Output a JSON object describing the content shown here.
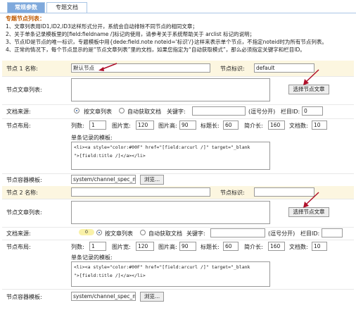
{
  "tabs": [
    {
      "label": "常规参数",
      "active": true
    },
    {
      "label": "专题文档",
      "active": false
    }
  ],
  "notes": {
    "title": "专题节点列表：",
    "lines": [
      "1、文章列表用ID1,ID2,ID3这样形式分开，系统会自动排除不同节点的相同文章；",
      "2、关于单条记录模板里的[field:fieldname /]标记的使用，请参考关于系统帮助关于 arclist 标记的说明；",
      "3、节点ID是节点的唯一标识，专题模板中用{dede:field.note noteid='标识'/}这样来表示单个节点，不指定noteid时为所有节点列表。",
      "4、正常的情况下，每个节点显示的是“节点文章列表”里的文档，如果您指定为“自动获取模式”，那么必须指定关键字和栏目ID。"
    ]
  },
  "node1": {
    "name_label": "节点 1 名称:",
    "name_value": "默认节点",
    "id_label": "节点标识:",
    "id_value": "default",
    "list_label": "节点文章列表:",
    "select_button": "选择节点文章",
    "source_label": "文档来源:",
    "source_opt1": "按文章列表",
    "source_opt2": "自动获取文档",
    "keyword_label": "关键字:",
    "keyword_hint": "(逗号分开)",
    "typeid_label": "栏目ID:",
    "typeid_value": "0",
    "layout_label": "节点布局:",
    "cols_label": "列数:",
    "cols_value": "1",
    "imgw_label": "图片宽:",
    "imgw_value": "120",
    "imgh_label": "图片高:",
    "imgh_value": "90",
    "titlelen_label": "标题长:",
    "titlelen_value": "60",
    "infolen_label": "简介长:",
    "infolen_value": "160",
    "rows_label": "文档数:",
    "rows_value": "10",
    "template_label": "单条记录的模板:",
    "template_line1": "<li><a style=\"color:#00F\" href=\"[field:arcurl /]\" target=\"_blank",
    "template_line2": "\">[field:title /]</a></li>",
    "container_label": "节点容器模板:",
    "container_value": "system/channel_spec_n",
    "browse_button": "浏览..."
  },
  "node2": {
    "name_label": "节点 2 名称:",
    "name_value": "",
    "id_label": "节点标识:",
    "id_value": "",
    "list_label": "节点文章列表:",
    "select_button": "选择节点文章",
    "source_label": "文档来源:",
    "source_badge": "0",
    "source_opt1": "按文章列表",
    "source_opt2": "自动获取文档",
    "keyword_label": "关键字:",
    "keyword_hint": "(逗号分开)",
    "typeid_label": "栏目ID:",
    "typeid_value": "",
    "layout_label": "节点布局:",
    "cols_label": "列数:",
    "cols_value": "1",
    "imgw_label": "图片宽:",
    "imgw_value": "120",
    "imgh_label": "图片高:",
    "imgh_value": "90",
    "titlelen_label": "标题长:",
    "titlelen_value": "60",
    "infolen_label": "简介长:",
    "infolen_value": "160",
    "rows_label": "文档数:",
    "rows_value": "10",
    "template_label": "单条记录的模板:",
    "template_line1": "<li><a style=\"color:#00F\" href=\"[field:arcurl /]\" target=\"_blank",
    "template_line2": "\">[field:title /]</a></li>",
    "container_label": "节点容器模板:",
    "container_value": "system/channel_spec_n",
    "browse_button": "浏览..."
  },
  "colors": {
    "tab_active": "#7fa9dc",
    "highlight_row": "#fcf6e0",
    "arrow": "#b0102a",
    "notes_title": "#c05a00"
  }
}
